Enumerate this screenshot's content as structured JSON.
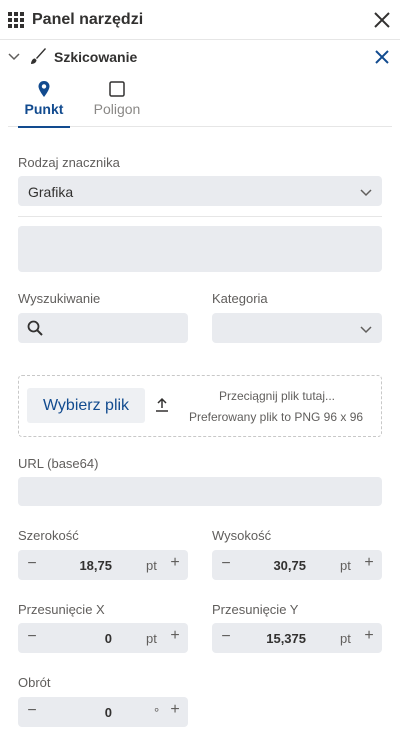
{
  "header": {
    "title": "Panel narzędzi"
  },
  "section": {
    "title": "Szkicowanie"
  },
  "tabs": [
    {
      "label": "Punkt",
      "active": true
    },
    {
      "label": "Poligon",
      "active": false
    }
  ],
  "marker_type": {
    "label": "Rodzaj znacznika",
    "value": "Grafika"
  },
  "search": {
    "label": "Wyszukiwanie",
    "value": ""
  },
  "category": {
    "label": "Kategoria",
    "value": ""
  },
  "upload": {
    "button": "Wybierz plik",
    "hint1": "Przeciągnij plik tutaj...",
    "hint2": "Preferowany plik to PNG 96 x 96"
  },
  "url": {
    "label": "URL (base64)",
    "value": ""
  },
  "width": {
    "label": "Szerokość",
    "value": "18,75",
    "unit": "pt"
  },
  "height": {
    "label": "Wysokość",
    "value": "30,75",
    "unit": "pt"
  },
  "offset_x": {
    "label": "Przesunięcie X",
    "value": "0",
    "unit": "pt"
  },
  "offset_y": {
    "label": "Przesunięcie Y",
    "value": "15,375",
    "unit": "pt"
  },
  "rotation": {
    "label": "Obrót",
    "value": "0",
    "unit": "°"
  },
  "colors": {
    "accent": "#124b8f",
    "field_bg": "#e9ebef"
  }
}
